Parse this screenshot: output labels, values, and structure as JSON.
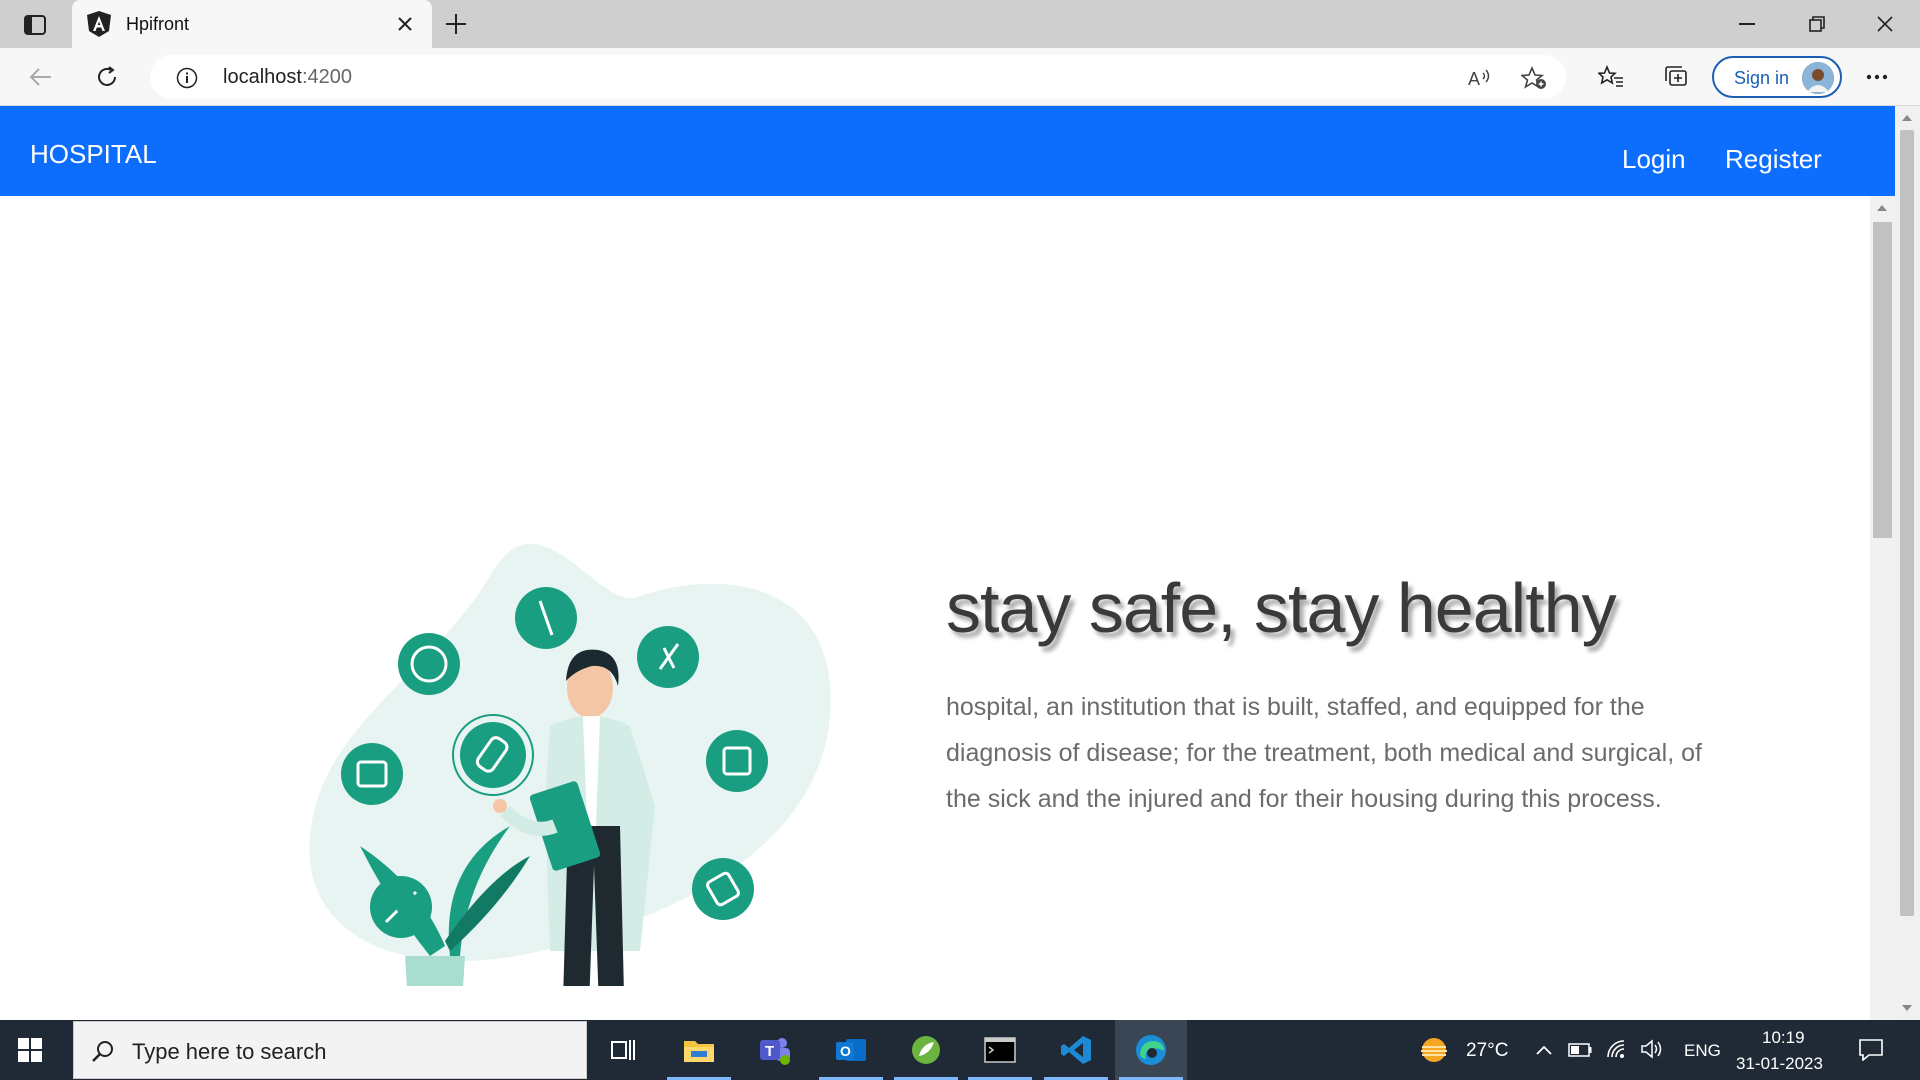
{
  "browser": {
    "tab_title": "Hpifront",
    "url_host": "localhost",
    "url_port": ":4200",
    "signin_label": "Sign in"
  },
  "navbar": {
    "brand": "HOSPITAL",
    "links": [
      "Login",
      "Register"
    ],
    "color": "#0d6efd"
  },
  "hero": {
    "headline": "stay safe, stay healthy",
    "description": "hospital, an institution that is built, staffed, and equipped for the diagnosis of disease; for the treatment, both medical and surgical, of the sick and the injured and for their housing during this process.",
    "accent": "#1a9e82"
  },
  "taskbar": {
    "search_placeholder": "Type here to search",
    "temperature": "27°C",
    "language": "ENG",
    "time": "10:19",
    "date": "31-01-2023"
  }
}
